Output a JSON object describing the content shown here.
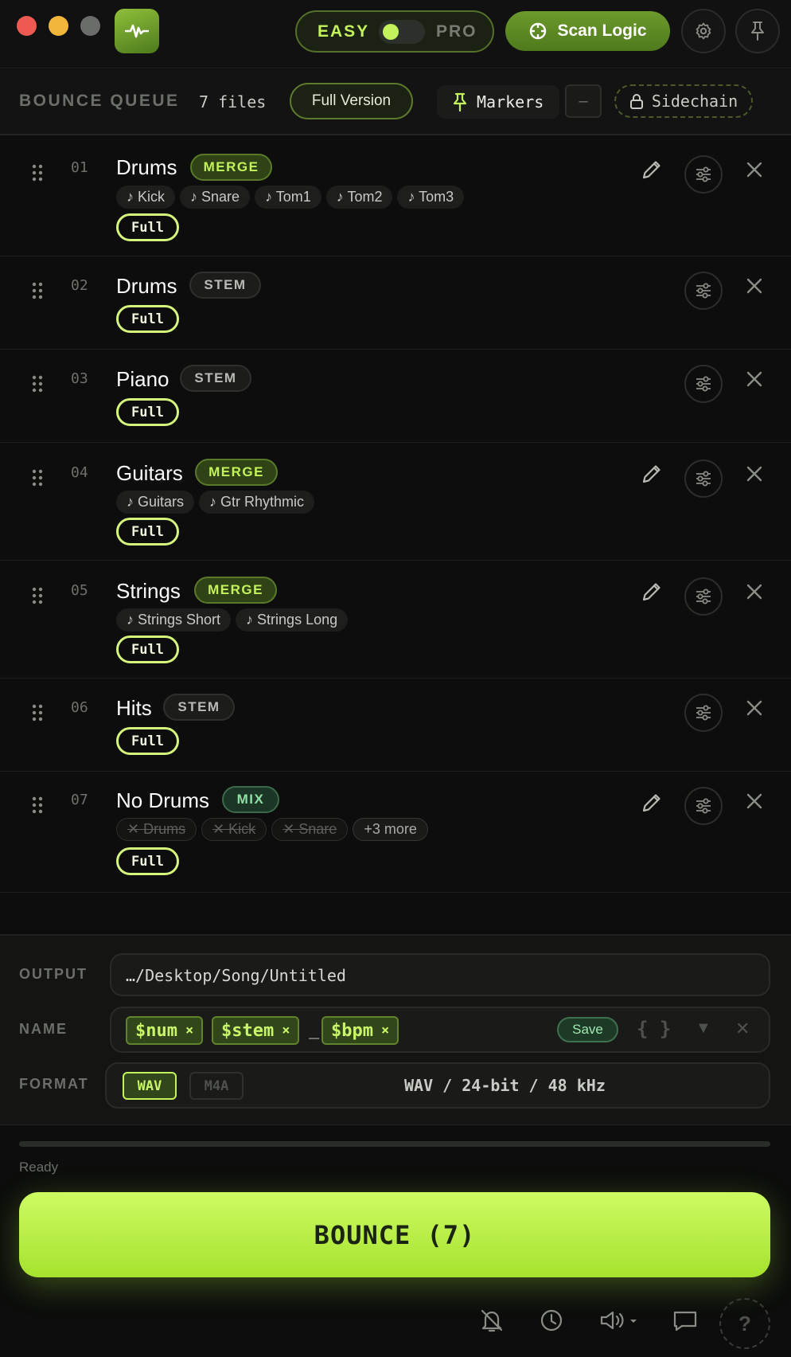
{
  "header": {
    "mode_easy": "EASY",
    "mode_pro": "PRO",
    "scan_label": "Scan Logic"
  },
  "queue": {
    "title": "BOUNCE QUEUE",
    "count": "7 files",
    "version_button": "Full Version",
    "markers_label": "Markers",
    "minus_label": "–",
    "sidechain_label": "Sidechain"
  },
  "rows": [
    {
      "num": "01",
      "name": "Drums",
      "badge": "MERGE",
      "chips": [
        "♪ Kick",
        "♪ Snare",
        "♪ Tom1",
        "♪ Tom2",
        "♪ Tom3"
      ],
      "range": "Full"
    },
    {
      "num": "02",
      "name": "Drums",
      "badge": "STEM",
      "range": "Full"
    },
    {
      "num": "03",
      "name": "Piano",
      "badge": "STEM",
      "range": "Full"
    },
    {
      "num": "04",
      "name": "Guitars",
      "badge": "MERGE",
      "chips": [
        "♪ Guitars",
        "♪ Gtr Rhythmic"
      ],
      "range": "Full"
    },
    {
      "num": "05",
      "name": "Strings",
      "badge": "MERGE",
      "chips": [
        "♪ Strings Short",
        "♪ Strings Long"
      ],
      "range": "Full"
    },
    {
      "num": "06",
      "name": "Hits",
      "badge": "STEM",
      "range": "Full"
    },
    {
      "num": "07",
      "name": "No Drums",
      "badge": "MIX",
      "chips": [
        "✕ Drums",
        "✕ Kick",
        "✕ Snare"
      ],
      "more": "+3 more",
      "range": "Full"
    }
  ],
  "output": {
    "label": "OUTPUT",
    "path": "…/Desktop/Song/Untitled"
  },
  "name": {
    "label": "NAME",
    "tokens": [
      "$num",
      "$stem",
      "$bpm"
    ],
    "token_remove": "×",
    "separator": "_",
    "save": "Save",
    "braces": "{ }",
    "dropdown": "▼",
    "clear": "✕"
  },
  "format": {
    "label": "FORMAT",
    "options": [
      "WAV",
      "M4A"
    ],
    "selected": "WAV",
    "summary": "WAV / 24-bit / 48 kHz"
  },
  "progress": {
    "value": 0
  },
  "status": "Ready",
  "bounce_label": "BOUNCE (7)",
  "help_label": "?",
  "colors": {
    "accent": "#c3f25a",
    "background": "#0c0d0c",
    "merge": "#c3f25a",
    "mix": "#8de0a4"
  },
  "icons": [
    "app-waveform-icon",
    "scan-target-icon",
    "gear-icon",
    "pin-icon",
    "lock-icon",
    "drag-grip-icon",
    "pencil-icon",
    "sliders-icon",
    "close-icon",
    "bell-off-icon",
    "clock-icon",
    "speaker-icon",
    "chat-icon"
  ]
}
